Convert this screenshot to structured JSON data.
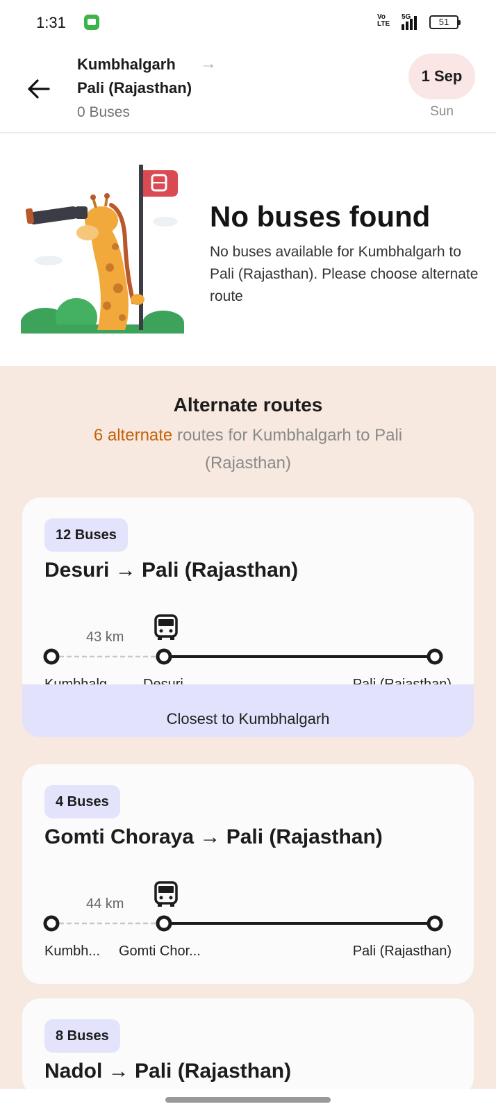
{
  "status_bar": {
    "time": "1:31",
    "volte": "Vo LTE",
    "network": "5G",
    "battery": "51"
  },
  "header": {
    "from": "Kumbhalgarh",
    "to": "Pali (Rajasthan)",
    "bus_count": "0 Buses",
    "date": "1 Sep",
    "day": "Sun"
  },
  "empty_state": {
    "title": "No buses found",
    "message": "No buses available for Kumbhalgarh to Pali (Rajasthan). Please choose alternate route"
  },
  "alternate": {
    "title": "Alternate routes",
    "count_highlight": "6 alternate",
    "count_rest": " routes for Kumbhalgarh to Pali (Rajasthan)",
    "cards": [
      {
        "badge": "12 Buses",
        "route": "Desuri → Pali (Rajasthan)",
        "distance": "43 km",
        "stop_origin": "Kumbhalg...",
        "stop_via": "Desuri",
        "stop_dest": "Pali (Rajasthan)",
        "footer": "Closest to Kumbhalgarh"
      },
      {
        "badge": "4 Buses",
        "route": "Gomti Choraya → Pali (Rajasthan)",
        "distance": "44 km",
        "stop_origin": "Kumbh...",
        "stop_via": "Gomti Chor...",
        "stop_dest": "Pali (Rajasthan)"
      },
      {
        "badge": "8 Buses",
        "route": "Nadol → Pali (Rajasthan)"
      }
    ]
  },
  "colors": {
    "accent_orange": "#c4620a",
    "section_bg": "#f7e9e0",
    "badge_bg": "#e3e4fb",
    "date_pill": "#fbe6e6"
  }
}
